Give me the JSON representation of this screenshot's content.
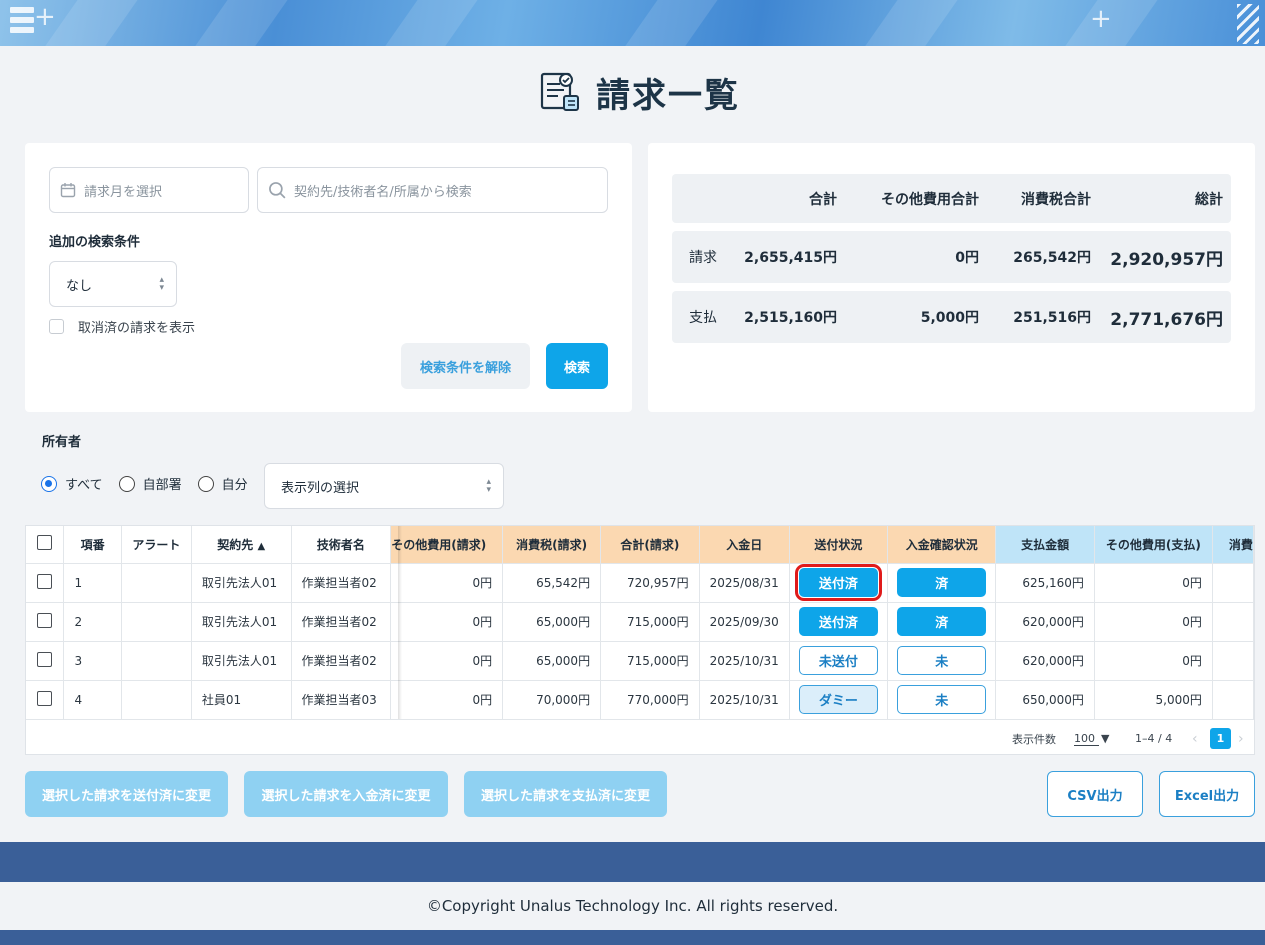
{
  "header": {
    "page_title": "請求一覧",
    "icon": "invoice-document-icon"
  },
  "search": {
    "month_placeholder": "請求月を選択",
    "keyword_placeholder": "契約先/技術者名/所属から検索",
    "additional_label": "追加の検索条件",
    "additional_value": "なし",
    "show_cancelled_label": "取消済の請求を表示",
    "clear_button": "検索条件を解除",
    "search_button": "検索"
  },
  "summary": {
    "headers": [
      "合計",
      "その他費用合計",
      "消費税合計",
      "総計"
    ],
    "rows": [
      {
        "label": "請求",
        "total": "2,655,415円",
        "other": "0円",
        "tax": "265,542円",
        "grand": "2,920,957円"
      },
      {
        "label": "支払",
        "total": "2,515,160円",
        "other": "5,000円",
        "tax": "251,516円",
        "grand": "2,771,676円"
      }
    ]
  },
  "owner": {
    "label": "所有者",
    "options": [
      "すべて",
      "自部署",
      "自分"
    ],
    "selected": "すべて",
    "column_select": "表示列の選択"
  },
  "table": {
    "headers": {
      "no": "項番",
      "alert": "アラート",
      "client": "契約先",
      "engineer": "技術者名",
      "other_claim": "その他費用(請求)",
      "tax_claim": "消費税(請求)",
      "total_claim": "合計(請求)",
      "payment_date": "入金日",
      "send_status": "送付状況",
      "deposit_status": "入金確認状況",
      "pay_amount": "支払金額",
      "other_pay": "その他費用(支払)",
      "tax_pay": "消費"
    },
    "sort_indicator": "▲",
    "rows": [
      {
        "no": "1",
        "client": "取引先法人01",
        "engineer": "作業担当者02",
        "other_claim": "0円",
        "tax_claim": "65,542円",
        "total_claim": "720,957円",
        "payment_date": "2025/08/31",
        "send_status": "送付済",
        "deposit_status": "済",
        "pay_amount": "625,160円",
        "other_pay": "0円"
      },
      {
        "no": "2",
        "client": "取引先法人01",
        "engineer": "作業担当者02",
        "other_claim": "0円",
        "tax_claim": "65,000円",
        "total_claim": "715,000円",
        "payment_date": "2025/09/30",
        "send_status": "送付済",
        "deposit_status": "済",
        "pay_amount": "620,000円",
        "other_pay": "0円"
      },
      {
        "no": "3",
        "client": "取引先法人01",
        "engineer": "作業担当者02",
        "other_claim": "0円",
        "tax_claim": "65,000円",
        "total_claim": "715,000円",
        "payment_date": "2025/10/31",
        "send_status": "未送付",
        "deposit_status": "未",
        "pay_amount": "620,000円",
        "other_pay": "0円"
      },
      {
        "no": "4",
        "client": "社員01",
        "engineer": "作業担当者03",
        "other_claim": "0円",
        "tax_claim": "70,000円",
        "total_claim": "770,000円",
        "payment_date": "2025/10/31",
        "send_status": "ダミー",
        "deposit_status": "未",
        "pay_amount": "650,000円",
        "other_pay": "5,000円"
      }
    ],
    "pager": {
      "rows_label": "表示件数",
      "rows_value": "100",
      "range": "1–4 / 4",
      "current_page": "1"
    }
  },
  "actions": {
    "mark_sent": "選択した請求を送付済に変更",
    "mark_deposited": "選択した請求を入金済に変更",
    "mark_paid": "選択した請求を支払済に変更",
    "csv": "CSV出力",
    "excel": "Excel出力"
  },
  "footer": {
    "copyright": "©Copyright Unalus Technology Inc. All rights reserved."
  },
  "colors": {
    "accent": "#0ea5e9",
    "highlight": "#e01b1b",
    "claim_header": "#fbd8b1",
    "pay_header": "#bfe4f8",
    "footer_band": "#3a5f98"
  }
}
